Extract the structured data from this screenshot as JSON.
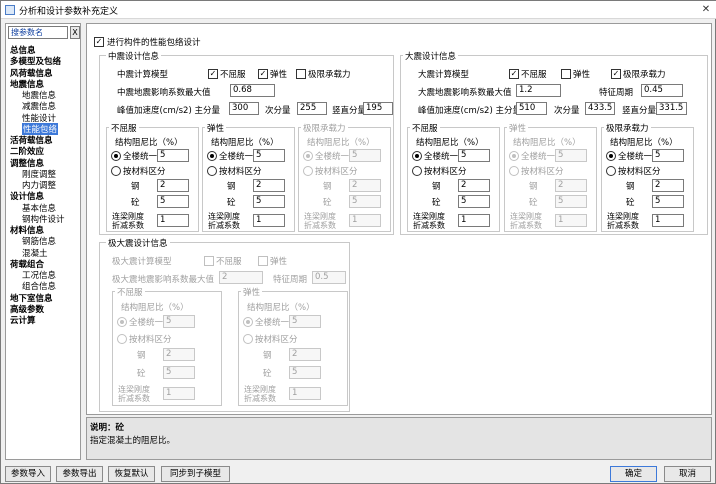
{
  "window": {
    "title": "分析和设计参数补充定义",
    "close": "✕"
  },
  "sidebar": {
    "search_value": "搜参数名",
    "clear": "X",
    "items": [
      {
        "label": "总信息",
        "bold": true
      },
      {
        "label": "多模型及包络",
        "bold": true
      },
      {
        "label": "风荷载信息",
        "bold": true
      },
      {
        "label": "地震信息",
        "bold": true
      },
      {
        "label": "地震信息"
      },
      {
        "label": "减震信息"
      },
      {
        "label": "性能设计"
      },
      {
        "label": "性能包络",
        "selected": true
      },
      {
        "label": "活荷载信息",
        "bold": true
      },
      {
        "label": "二阶效应",
        "bold": true
      },
      {
        "label": "调整信息",
        "bold": true
      },
      {
        "label": "刚度调整"
      },
      {
        "label": "内力调整"
      },
      {
        "label": "设计信息",
        "bold": true
      },
      {
        "label": "基本信息"
      },
      {
        "label": "钢构件设计"
      },
      {
        "label": "材料信息",
        "bold": true
      },
      {
        "label": "钢筋信息"
      },
      {
        "label": "混凝土"
      },
      {
        "label": "荷载组合",
        "bold": true
      },
      {
        "label": "工况信息"
      },
      {
        "label": "组合信息"
      },
      {
        "label": "地下室信息",
        "bold": true
      },
      {
        "label": "高级参数",
        "bold": true
      },
      {
        "label": "云计算",
        "bold": true
      }
    ]
  },
  "main": {
    "envelope_label": "进行构件的性能包络设计",
    "common": {
      "damping_title": "结构阻尼比（%）",
      "uniform": "全楼统一",
      "by_material": "按材料区分",
      "steel": "钢",
      "concrete": "砼",
      "coupling": "连梁刚度",
      "coupling2": "折减系数"
    },
    "mid": {
      "title": "中震设计信息",
      "model_label": "中震计算模型",
      "opt1": "不屈服",
      "opt2": "弹性",
      "opt3": "极限承载力",
      "alpha_label": "中震地震影响系数最大值",
      "alpha": "0.68",
      "peak_label": "峰值加速度(cm/s2) 主分量",
      "peak_main": "300",
      "sub_label": "次分量",
      "peak_sub": "255",
      "vert_label": "竖直分量",
      "peak_vert": "195",
      "groups": [
        {
          "title": "不屈服",
          "uniform": "5",
          "steel": "2",
          "concrete": "5",
          "coupling": "1"
        },
        {
          "title": "弹性",
          "uniform": "5",
          "steel": "2",
          "concrete": "5",
          "coupling": "1"
        },
        {
          "title": "极限承载力",
          "uniform": "5",
          "steel": "2",
          "concrete": "5",
          "coupling": "1"
        }
      ]
    },
    "big": {
      "title": "大震设计信息",
      "model_label": "大震计算模型",
      "opt1": "不屈服",
      "opt2": "弹性",
      "opt3": "极限承载力",
      "alpha_label": "大震地震影响系数最大值",
      "alpha": "1.2",
      "period_label": "特征周期",
      "period": "0.45",
      "peak_label": "峰值加速度(cm/s2) 主分量",
      "peak_main": "510",
      "sub_label": "次分量",
      "peak_sub": "433.5",
      "vert_label": "竖直分量",
      "peak_vert": "331.5",
      "groups": [
        {
          "title": "不屈服",
          "uniform": "5",
          "steel": "2",
          "concrete": "5",
          "coupling": "1"
        },
        {
          "title": "弹性",
          "uniform": "5",
          "steel": "2",
          "concrete": "5",
          "coupling": "1"
        },
        {
          "title": "极限承载力",
          "uniform": "5",
          "steel": "2",
          "concrete": "5",
          "coupling": "1"
        }
      ]
    },
    "extreme": {
      "title": "极大震设计信息",
      "model_label": "极大震计算模型",
      "opt1": "不屈服",
      "opt2": "弹性",
      "alpha_label": "极大震地震影响系数最大值",
      "alpha": "2",
      "period_label": "特征周期",
      "period": "0.5",
      "groups": [
        {
          "title": "不屈服",
          "uniform": "5",
          "steel": "2",
          "concrete": "5",
          "coupling": "1"
        },
        {
          "title": "弹性",
          "uniform": "5",
          "steel": "2",
          "concrete": "5",
          "coupling": "1"
        }
      ]
    }
  },
  "description": {
    "title": "说明：砼",
    "text": "指定混凝土的阻尼比。"
  },
  "buttons": {
    "import": "参数导入",
    "export": "参数导出",
    "restore": "恢复默认",
    "sync": "同步到子模型",
    "ok": "确定",
    "cancel": "取消"
  }
}
